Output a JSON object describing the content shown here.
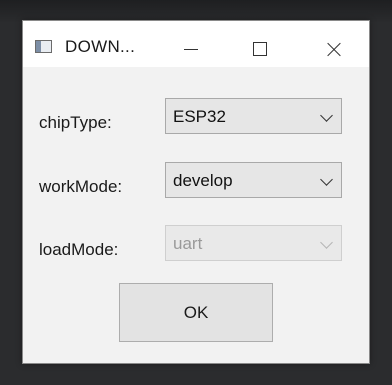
{
  "window": {
    "title": "DOWN...",
    "controls": [
      "minimize-icon",
      "maximize-icon",
      "close-icon"
    ]
  },
  "form": {
    "chip_type": {
      "label": "chipType:",
      "value": "ESP32"
    },
    "work_mode": {
      "label": "workMode:",
      "value": "develop"
    },
    "load_mode": {
      "label": "loadMode:",
      "value": "uart",
      "disabled": true
    }
  },
  "buttons": {
    "ok_label": "OK"
  }
}
